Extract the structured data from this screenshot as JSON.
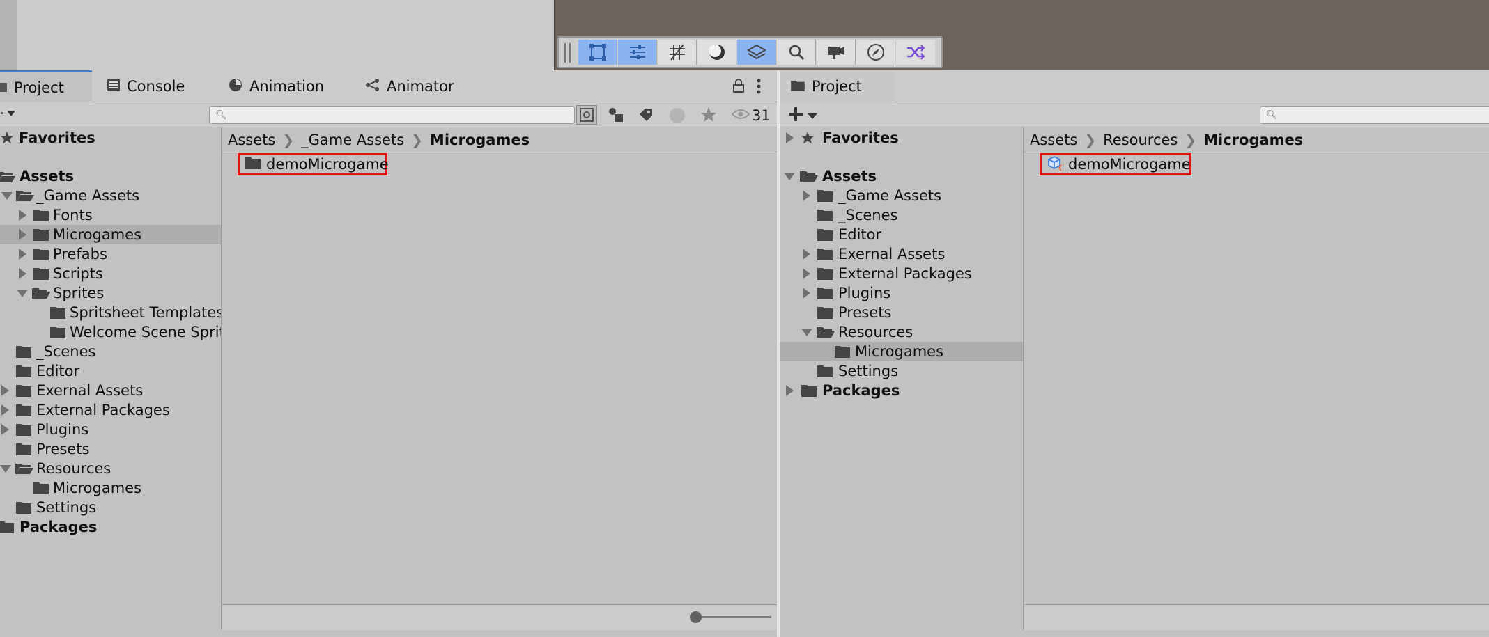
{
  "left_window": {
    "tabs": [
      {
        "label": "Project",
        "icon": "folder-icon",
        "active": true
      },
      {
        "label": "Console",
        "icon": "console-icon"
      },
      {
        "label": "Animation",
        "icon": "animation-icon"
      },
      {
        "label": "Animator",
        "icon": "animator-icon"
      }
    ],
    "search": {
      "placeholder": "",
      "value": ""
    },
    "toolbar": {
      "hidden_count": "31"
    },
    "tree": [
      {
        "label": "Favorites",
        "bold": true
      },
      {
        "label": "Assets",
        "bold": true
      },
      {
        "label": "_Game Assets"
      },
      {
        "label": "Fonts"
      },
      {
        "label": "Microgames",
        "selected": true
      },
      {
        "label": "Prefabs"
      },
      {
        "label": "Scripts"
      },
      {
        "label": "Sprites"
      },
      {
        "label": "Spritsheet Templates"
      },
      {
        "label": "Welcome Scene Sprites"
      },
      {
        "label": "_Scenes"
      },
      {
        "label": "Editor"
      },
      {
        "label": "Exernal Assets"
      },
      {
        "label": "External Packages"
      },
      {
        "label": "Plugins"
      },
      {
        "label": "Presets"
      },
      {
        "label": "Resources"
      },
      {
        "label": "Microgames"
      },
      {
        "label": "Settings"
      },
      {
        "label": "Packages",
        "bold": true
      }
    ],
    "breadcrumb": [
      "Assets",
      "_Game Assets",
      "Microgames"
    ],
    "items": [
      {
        "label": "demoMicrogame",
        "type": "folder"
      }
    ],
    "zoom_slider": 0
  },
  "right_window": {
    "tabs": [
      {
        "label": "Project",
        "icon": "folder-icon",
        "active": true
      }
    ],
    "search": {
      "placeholder": "",
      "value": ""
    },
    "tree": [
      {
        "label": "Favorites",
        "bold": true
      },
      {
        "label": "Assets",
        "bold": true
      },
      {
        "label": "_Game Assets"
      },
      {
        "label": "_Scenes"
      },
      {
        "label": "Editor"
      },
      {
        "label": "Exernal Assets"
      },
      {
        "label": "External Packages"
      },
      {
        "label": "Plugins"
      },
      {
        "label": "Presets"
      },
      {
        "label": "Resources"
      },
      {
        "label": "Microgames",
        "selected": true
      },
      {
        "label": "Settings"
      },
      {
        "label": "Packages",
        "bold": true
      }
    ],
    "breadcrumb": [
      "Assets",
      "Resources",
      "Microgames"
    ],
    "items": [
      {
        "label": "demoMicrogame",
        "type": "prefab"
      }
    ]
  },
  "scene_toolbar": {
    "tools": [
      "rect-tool-icon",
      "transform-tool-icon",
      "grid-snap-icon",
      "shading-icon",
      "layers-icon",
      "search-icon",
      "camera-icon",
      "compass-icon",
      "shuffle-icon"
    ],
    "active": [
      0,
      1,
      4
    ]
  },
  "colors": {
    "accent": "#3a7bd5",
    "selection": "#adadad",
    "highlight_box": "#e01515",
    "active_tool": "#8ab3ef"
  }
}
